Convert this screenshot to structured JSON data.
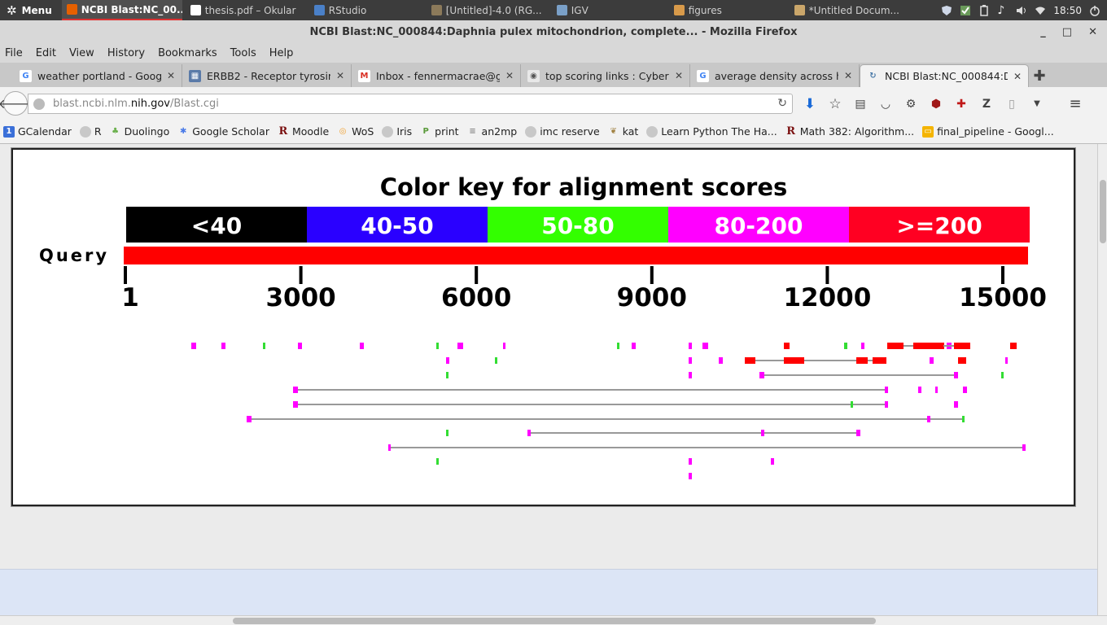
{
  "panel": {
    "menu_label": "Menu",
    "tasks": [
      {
        "label": "NCBI Blast:NC_00...",
        "icon_color": "#e66000",
        "icon": "firefox-icon"
      },
      {
        "label": "thesis.pdf – Okular",
        "icon_color": "#ffffff",
        "icon": "document-icon"
      },
      {
        "label": "RStudio",
        "icon_color": "#4a80c8",
        "icon": "rstudio-icon"
      },
      {
        "label": "[Untitled]-4.0 (RG...",
        "icon_color": "#8c7a5a",
        "icon": "gimp-icon"
      },
      {
        "label": "IGV",
        "icon_color": "#7aa0c8",
        "icon": "igv-icon"
      },
      {
        "label": "figures",
        "icon_color": "#d89a4a",
        "icon": "folder-icon"
      },
      {
        "label": "*Untitled Docum...",
        "icon_color": "#caa66a",
        "icon": "text-editor-icon"
      }
    ],
    "clock": "18:50"
  },
  "window": {
    "title": "NCBI Blast:NC_000844:Daphnia pulex mitochondrion, complete... - Mozilla Firefox",
    "controls": [
      "_",
      "□",
      "✕"
    ]
  },
  "menubar": [
    "File",
    "Edit",
    "View",
    "History",
    "Bookmarks",
    "Tools",
    "Help"
  ],
  "tabs": [
    {
      "label": "weather portland - Googl...",
      "icon": "google-icon",
      "active": false
    },
    {
      "label": "ERBB2 - Receptor tyrosin...",
      "icon": "uniprot-icon",
      "active": false
    },
    {
      "label": "Inbox - fennermacrae@g...",
      "icon": "gmail-icon",
      "active": false
    },
    {
      "label": "top scoring links : Cyberp...",
      "icon": "reddit-icon",
      "active": false
    },
    {
      "label": "average density across hi...",
      "icon": "google-icon",
      "active": false
    },
    {
      "label": "NCBI Blast:NC_000844:D...",
      "icon": "loading-icon",
      "active": true
    }
  ],
  "url": {
    "prefix": "blast.ncbi.nlm.",
    "host": "nih.gov",
    "path": "/Blast.cgi"
  },
  "bookmarks": [
    {
      "label": "GCalendar",
      "icon": "calendar-icon",
      "color": "#3a6fd8",
      "glyph": "1"
    },
    {
      "label": "R",
      "icon": "globe-icon",
      "color": "#999",
      "glyph": ""
    },
    {
      "label": "Duolingo",
      "icon": "duolingo-icon",
      "color": "#6ab04c",
      "glyph": "♣"
    },
    {
      "label": "Google Scholar",
      "icon": "scholar-icon",
      "color": "#4a7ae8",
      "glyph": "✱"
    },
    {
      "label": "Moodle",
      "icon": "moodle-icon",
      "color": "#ffffff",
      "glyph": "R"
    },
    {
      "label": "WoS",
      "icon": "wos-icon",
      "color": "#f0a030",
      "glyph": "◎"
    },
    {
      "label": "Iris",
      "icon": "globe-icon",
      "color": "#999",
      "glyph": ""
    },
    {
      "label": "print",
      "icon": "print-icon",
      "color": "#5a9a3a",
      "glyph": "P"
    },
    {
      "label": "an2mp",
      "icon": "an2mp-icon",
      "color": "#888",
      "glyph": "≡"
    },
    {
      "label": "imc reserve",
      "icon": "globe-icon",
      "color": "#999",
      "glyph": ""
    },
    {
      "label": "kat",
      "icon": "kat-icon",
      "color": "#a08040",
      "glyph": "❦"
    },
    {
      "label": "Learn Python The Ha...",
      "icon": "globe-icon",
      "color": "#999",
      "glyph": ""
    },
    {
      "label": "Math 382: Algorithm...",
      "icon": "moodle-icon",
      "color": "#ffffff",
      "glyph": "R"
    },
    {
      "label": "final_pipeline - Googl...",
      "icon": "slides-icon",
      "color": "#f4b400",
      "glyph": "▭"
    }
  ],
  "blast": {
    "title": "Color key for alignment scores",
    "key": [
      {
        "label": "<40",
        "color": "#000000"
      },
      {
        "label": "40-50",
        "color": "#2a00ff"
      },
      {
        "label": "50-80",
        "color": "#33ff00"
      },
      {
        "label": "80-200",
        "color": "#ff00ff"
      },
      {
        "label": ">=200",
        "color": "#ff0022"
      }
    ],
    "query_label": "Query",
    "query_color": "#ff0000",
    "axis_ticks": [
      "1",
      "3000",
      "6000",
      "9000",
      "12000",
      "15000"
    ],
    "axis_max": 15000
  }
}
